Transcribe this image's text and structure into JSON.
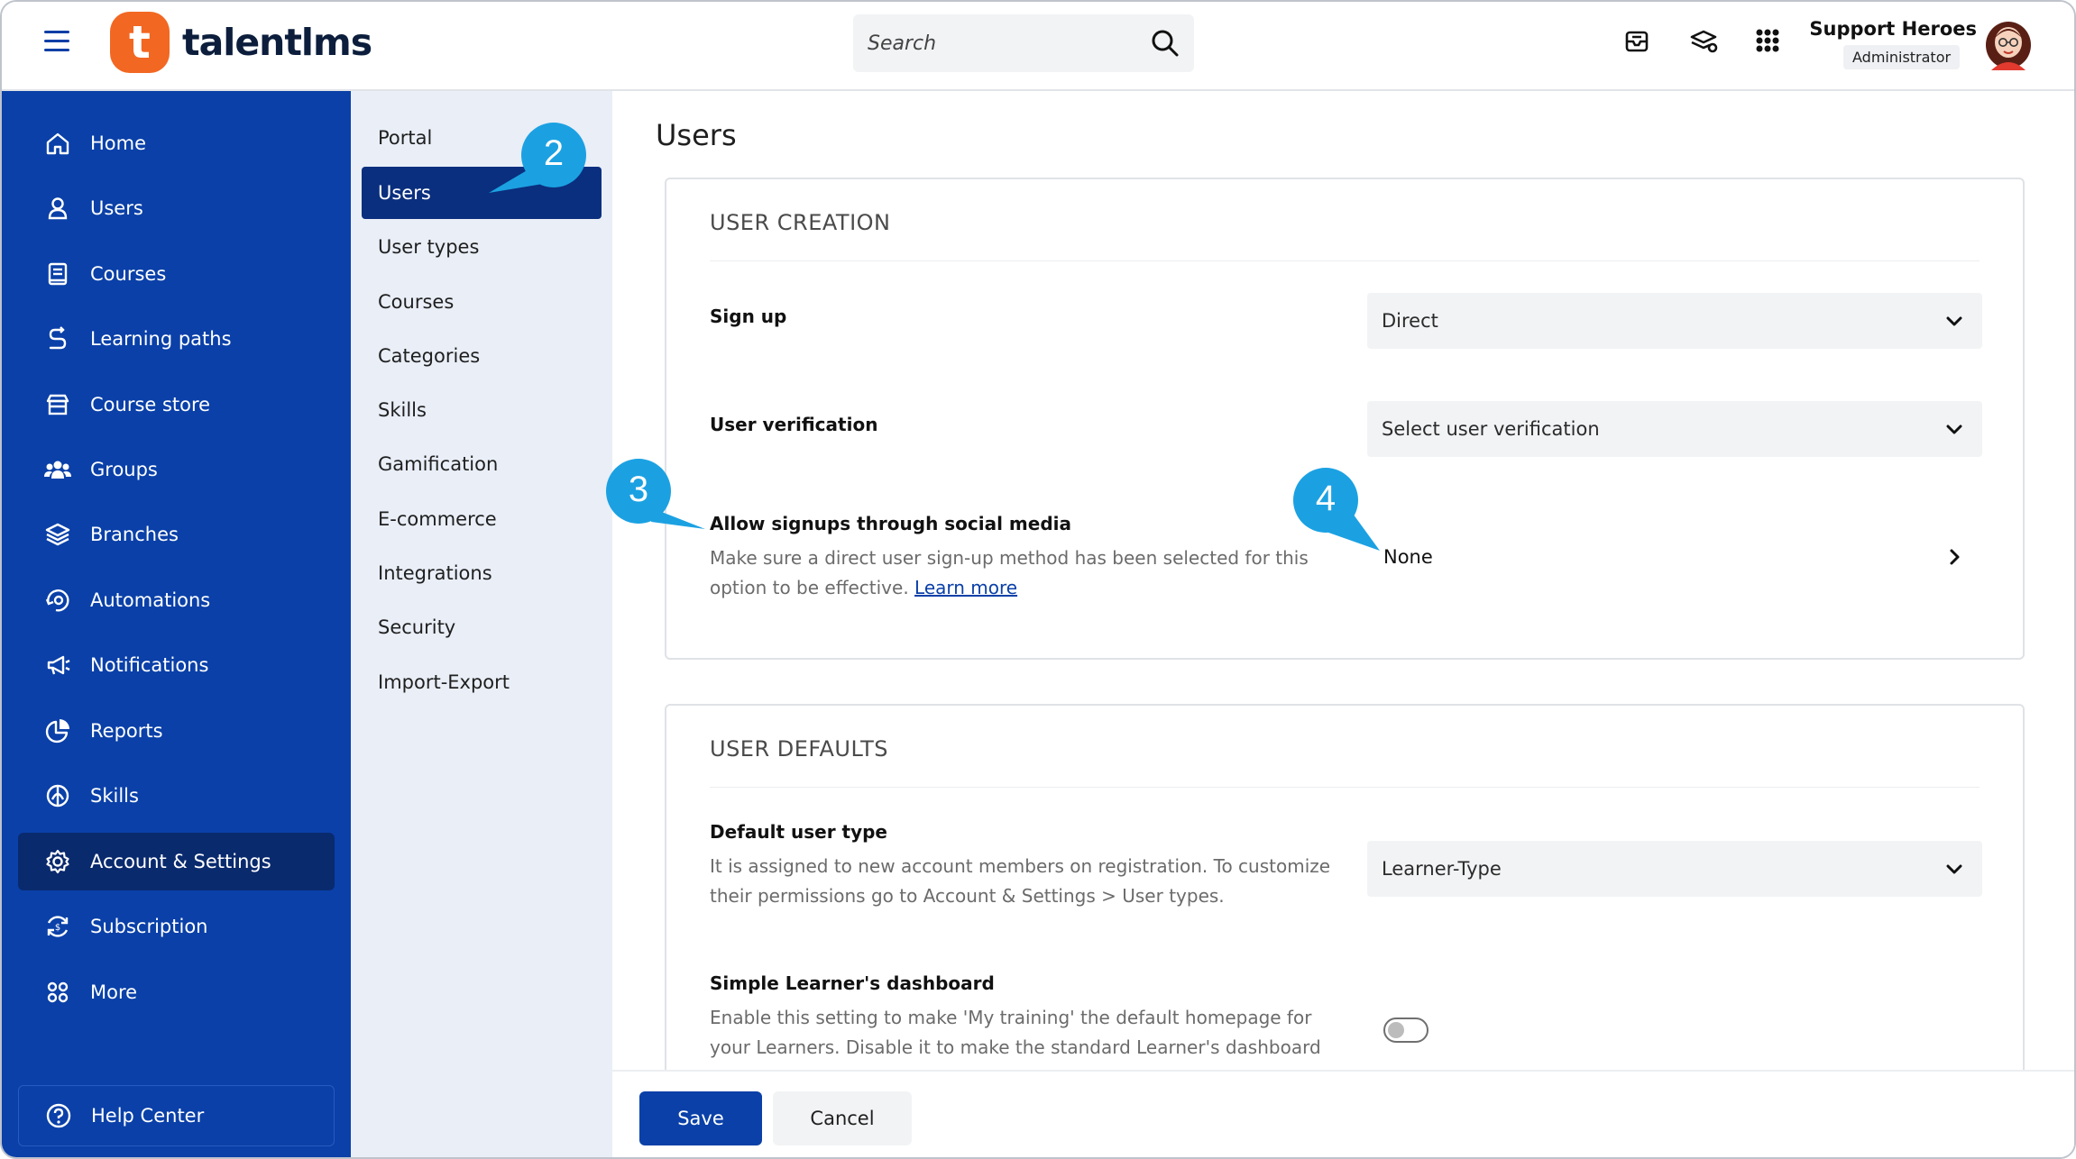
{
  "app": {
    "logo_text": "talentlms",
    "logo_mark": "t"
  },
  "header": {
    "search_placeholder": "Search",
    "user_name": "Support Heroes",
    "user_role": "Administrator",
    "icons": [
      "menu-icon",
      "search-icon",
      "messages-icon",
      "learner-switch-icon",
      "apps-grid-icon"
    ]
  },
  "leftnav": {
    "items": [
      {
        "label": "Home",
        "icon": "home-icon"
      },
      {
        "label": "Users",
        "icon": "user-icon"
      },
      {
        "label": "Courses",
        "icon": "book-icon"
      },
      {
        "label": "Learning paths",
        "icon": "path-icon"
      },
      {
        "label": "Course store",
        "icon": "store-icon"
      },
      {
        "label": "Groups",
        "icon": "groups-icon"
      },
      {
        "label": "Branches",
        "icon": "layers-icon"
      },
      {
        "label": "Automations",
        "icon": "automation-icon"
      },
      {
        "label": "Notifications",
        "icon": "megaphone-icon"
      },
      {
        "label": "Reports",
        "icon": "pie-chart-icon"
      },
      {
        "label": "Skills",
        "icon": "skills-icon"
      },
      {
        "label": "Account & Settings",
        "icon": "gear-icon",
        "active": true
      },
      {
        "label": "Subscription",
        "icon": "subscription-icon"
      },
      {
        "label": "More",
        "icon": "more-icon"
      }
    ],
    "help_label": "Help Center"
  },
  "subnav": {
    "items": [
      {
        "label": "Portal"
      },
      {
        "label": "Users",
        "active": true
      },
      {
        "label": "User types"
      },
      {
        "label": "Courses"
      },
      {
        "label": "Categories"
      },
      {
        "label": "Skills"
      },
      {
        "label": "Gamification"
      },
      {
        "label": "E-commerce"
      },
      {
        "label": "Integrations"
      },
      {
        "label": "Security"
      },
      {
        "label": "Import-Export"
      }
    ]
  },
  "main": {
    "title": "Users",
    "user_creation": {
      "title": "USER CREATION",
      "sign_up_label": "Sign up",
      "sign_up_value": "Direct",
      "verification_label": "User verification",
      "verification_value": "Select user verification",
      "social_label": "Allow signups through social media",
      "social_desc": "Make sure a direct user sign-up method has been selected for this option to be effective.",
      "social_link": "Learn more",
      "social_value": "None"
    },
    "user_defaults": {
      "title": "USER DEFAULTS",
      "default_type_label": "Default user type",
      "default_type_desc": "It is assigned to new account members on registration. To customize their permissions go to Account & Settings > User types.",
      "default_type_value": "Learner-Type",
      "simple_dashboard_label": "Simple Learner's dashboard",
      "simple_dashboard_desc": "Enable this setting to make 'My training' the default homepage for your Learners. Disable it to make the standard Learner's dashboard",
      "simple_dashboard_enabled": false
    }
  },
  "footer": {
    "save_label": "Save",
    "cancel_label": "Cancel"
  },
  "callouts": [
    "2",
    "3",
    "4"
  ],
  "colors": {
    "primary": "#0a40a8",
    "nav_active": "#0a2a6e",
    "brand_orange": "#f26722",
    "callout": "#1ba1e2"
  }
}
